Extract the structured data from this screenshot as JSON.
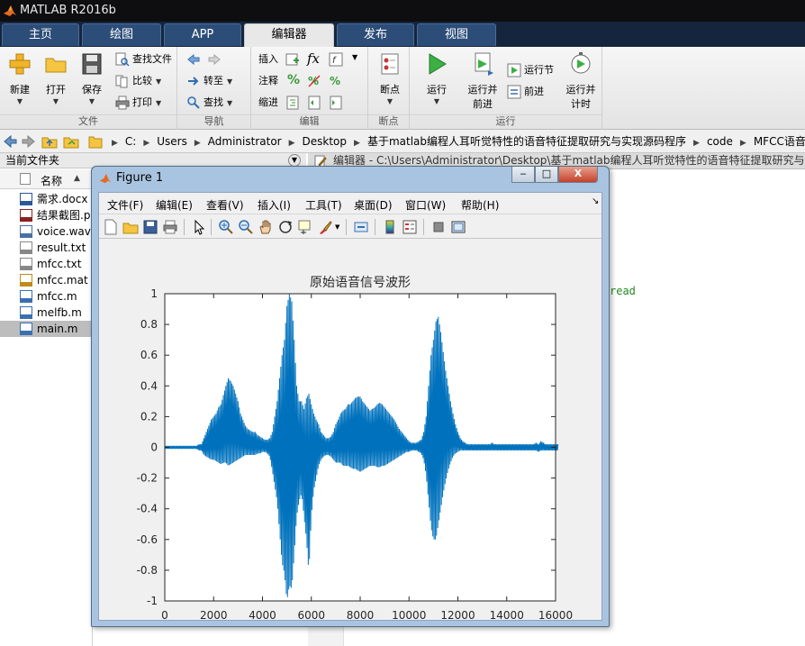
{
  "window": {
    "title": "MATLAB R2016b"
  },
  "ribbon": {
    "tabs": [
      "主页",
      "绘图",
      "APP",
      "编辑器",
      "发布",
      "视图"
    ],
    "active_tab": "编辑器",
    "file": {
      "new": "新建",
      "open": "打开",
      "save": "保存",
      "find_files": "查找文件",
      "compare": "比较",
      "print": "打印",
      "section": "文件"
    },
    "navigate": {
      "goto": "转至",
      "find": "查找",
      "section": "导航"
    },
    "edit": {
      "insert": "插入",
      "comment": "注释",
      "indent": "缩进",
      "section": "编辑",
      "fx": "fx"
    },
    "breakpoints": {
      "label": "断点",
      "section": "断点"
    },
    "run": {
      "run": "运行",
      "run_advance_1": "运行并",
      "run_advance_2": "前进",
      "run_section": "运行节",
      "advance": "前进",
      "run_time_1": "运行并",
      "run_time_2": "计时",
      "section": "运行"
    }
  },
  "address": {
    "crumbs": [
      "C:",
      "Users",
      "Administrator",
      "Desktop",
      "基于matlab编程人耳听觉特性的语音特征提取研究与实现源码程序",
      "code",
      "MFCC语音"
    ]
  },
  "current_folder": {
    "title": "当前文件夹",
    "name_col": "名称",
    "sort_indicator": "▲",
    "files": [
      {
        "name": "需求.docx",
        "icon": "word-doc-icon",
        "color": "#2b579a"
      },
      {
        "name": "结果截图.png",
        "icon": "png-image-icon",
        "color": "#8b2020"
      },
      {
        "name": "voice.wav",
        "icon": "wav-audio-icon",
        "color": "#4a6fa5"
      },
      {
        "name": "result.txt",
        "icon": "text-file-icon",
        "color": "#888888"
      },
      {
        "name": "mfcc.txt",
        "icon": "text-file-icon",
        "color": "#888888"
      },
      {
        "name": "mfcc.mat",
        "icon": "mat-file-icon",
        "color": "#c08a1e"
      },
      {
        "name": "mfcc.m",
        "icon": "m-file-icon",
        "color": "#3a6fb0"
      },
      {
        "name": "melfb.m",
        "icon": "m-file-icon",
        "color": "#3a6fb0"
      },
      {
        "name": "main.m",
        "icon": "m-file-icon",
        "color": "#3a6fb0"
      }
    ],
    "selected": "main.m"
  },
  "editor": {
    "title": "编辑器 - C:\\Users\\Administrator\\Desktop\\基于matlab编程人耳听觉特性的语音特征提取研究与实",
    "visible_code": "read"
  },
  "figure": {
    "title": "Figure 1",
    "menu": [
      "文件(F)",
      "编辑(E)",
      "查看(V)",
      "插入(I)",
      "工具(T)",
      "桌面(D)",
      "窗口(W)",
      "帮助(H)"
    ],
    "window_buttons": {
      "minimize": "‒",
      "maximize": "□",
      "close": "X"
    }
  },
  "chart_data": {
    "type": "line",
    "title": "原始语音信号波形",
    "xlabel": "",
    "ylabel": "",
    "xlim": [
      0,
      16000
    ],
    "ylim": [
      -1,
      1
    ],
    "x_ticks": [
      0,
      2000,
      4000,
      6000,
      8000,
      10000,
      12000,
      14000,
      16000
    ],
    "y_ticks": [
      -1,
      -0.8,
      -0.6,
      -0.4,
      -0.2,
      0,
      0.2,
      0.4,
      0.6,
      0.8,
      1
    ],
    "x_tick_labels": [
      "0",
      "2000",
      "4000",
      "6000",
      "8000",
      "10000",
      "12000",
      "14000",
      "16000"
    ],
    "y_tick_labels": [
      "-1",
      "-0.8",
      "-0.6",
      "-0.4",
      "-0.2",
      "0",
      "0.2",
      "0.4",
      "0.6",
      "0.8",
      "1"
    ],
    "grid": false,
    "line_color": "#0072bd",
    "series": [
      {
        "envelope_sample_step": 100,
        "envelope_upper": [
          0.01,
          0.01,
          0.01,
          0.01,
          0.01,
          0.01,
          0.01,
          0.01,
          0.01,
          0.01,
          0.01,
          0.01,
          0.01,
          0.01,
          0.02,
          0.02,
          0.06,
          0.1,
          0.14,
          0.18,
          0.2,
          0.22,
          0.26,
          0.28,
          0.34,
          0.4,
          0.45,
          0.43,
          0.4,
          0.35,
          0.3,
          0.22,
          0.18,
          0.14,
          0.12,
          0.11,
          0.1,
          0.1,
          0.08,
          0.07,
          0.06,
          0.05,
          0.05,
          0.06,
          0.1,
          0.2,
          0.3,
          0.45,
          0.6,
          0.7,
          0.92,
          1.0,
          0.95,
          0.7,
          0.4,
          0.3,
          0.3,
          0.25,
          0.32,
          0.35,
          0.28,
          0.22,
          0.18,
          0.15,
          0.1,
          0.08,
          0.06,
          0.06,
          0.07,
          0.1,
          0.15,
          0.18,
          0.22,
          0.24,
          0.25,
          0.28,
          0.28,
          0.3,
          0.32,
          0.33,
          0.33,
          0.3,
          0.28,
          0.26,
          0.24,
          0.25,
          0.26,
          0.28,
          0.29,
          0.28,
          0.26,
          0.24,
          0.22,
          0.2,
          0.18,
          0.15,
          0.12,
          0.1,
          0.08,
          0.06,
          0.04,
          0.03,
          0.03,
          0.03,
          0.04,
          0.05,
          0.1,
          0.2,
          0.4,
          0.6,
          0.7,
          0.82,
          0.85,
          0.75,
          0.62,
          0.5,
          0.4,
          0.3,
          0.22,
          0.15,
          0.1,
          0.06,
          0.04,
          0.03,
          0.02,
          0.02,
          0.02,
          0.02,
          0.02,
          0.02,
          0.02,
          0.02,
          0.02,
          0.02,
          0.03,
          0.02,
          0.02,
          0.02,
          0.02,
          0.02,
          0.02,
          0.02,
          0.02,
          0.02,
          0.02,
          0.02,
          0.02,
          0.02,
          0.02,
          0.02,
          0.02,
          0.02,
          0.03,
          0.02,
          0.04,
          0.03,
          0.02,
          0.02,
          0.02,
          0.02,
          0.02,
          0.02,
          0.02,
          0.02
        ],
        "envelope_lower": [
          -0.01,
          -0.01,
          -0.01,
          -0.01,
          -0.01,
          -0.01,
          -0.01,
          -0.01,
          -0.01,
          -0.01,
          -0.01,
          -0.01,
          -0.01,
          -0.01,
          -0.02,
          -0.02,
          -0.05,
          -0.06,
          -0.07,
          -0.08,
          -0.08,
          -0.09,
          -0.1,
          -0.11,
          -0.1,
          -0.1,
          -0.12,
          -0.11,
          -0.1,
          -0.09,
          -0.08,
          -0.07,
          -0.06,
          -0.05,
          -0.05,
          -0.05,
          -0.05,
          -0.05,
          -0.04,
          -0.04,
          -0.03,
          -0.03,
          -0.04,
          -0.06,
          -0.15,
          -0.25,
          -0.35,
          -0.55,
          -0.75,
          -0.82,
          -1.0,
          -0.9,
          -0.92,
          -0.7,
          -0.45,
          -0.35,
          -0.3,
          -0.45,
          -0.6,
          -0.82,
          -0.45,
          -0.28,
          -0.2,
          -0.12,
          -0.08,
          -0.06,
          -0.05,
          -0.05,
          -0.06,
          -0.08,
          -0.1,
          -0.1,
          -0.1,
          -0.12,
          -0.12,
          -0.12,
          -0.13,
          -0.14,
          -0.14,
          -0.15,
          -0.16,
          -0.15,
          -0.14,
          -0.13,
          -0.12,
          -0.12,
          -0.12,
          -0.13,
          -0.13,
          -0.12,
          -0.12,
          -0.11,
          -0.1,
          -0.09,
          -0.08,
          -0.07,
          -0.06,
          -0.05,
          -0.04,
          -0.03,
          -0.03,
          -0.02,
          -0.02,
          -0.02,
          -0.03,
          -0.04,
          -0.08,
          -0.18,
          -0.35,
          -0.52,
          -0.6,
          -0.6,
          -0.5,
          -0.4,
          -0.3,
          -0.22,
          -0.15,
          -0.1,
          -0.06,
          -0.04,
          -0.03,
          -0.02,
          -0.02,
          -0.02,
          -0.02,
          -0.02,
          -0.02,
          -0.02,
          -0.02,
          -0.02,
          -0.02,
          -0.02,
          -0.02,
          -0.02,
          -0.02,
          -0.02,
          -0.02,
          -0.02,
          -0.02,
          -0.02,
          -0.02,
          -0.02,
          -0.02,
          -0.02,
          -0.02,
          -0.02,
          -0.02,
          -0.02,
          -0.02,
          -0.02,
          -0.02,
          -0.02,
          -0.02,
          -0.03,
          -0.02,
          -0.02,
          -0.02,
          -0.02,
          -0.02,
          -0.02,
          -0.02,
          -0.02
        ]
      }
    ]
  }
}
